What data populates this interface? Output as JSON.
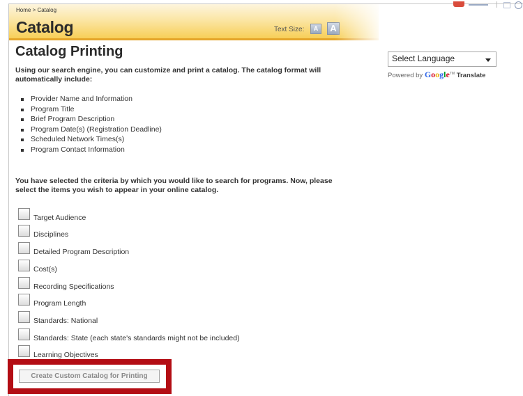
{
  "header": {
    "breadcrumb": "Home > Catalog",
    "title": "Catalog",
    "text_size_label": "Text Size:",
    "text_size_small": "A",
    "text_size_large": "A"
  },
  "content": {
    "title": "Catalog Printing",
    "intro": "Using our search engine, you can customize and print a catalog. The catalog format will automatically include:",
    "format_items": [
      "Provider Name and Information",
      "Program Title",
      "Brief Program Description",
      "Program Date(s) (Registration Deadline)",
      "Scheduled Network Times(s)",
      "Program Contact Information"
    ],
    "criteria_text": "You have selected the criteria by which you would like to search for programs. Now, please select the items you wish to appear in your online catalog.",
    "options": [
      {
        "label": "Target Audience",
        "checked": false
      },
      {
        "label": "Disciplines",
        "checked": false
      },
      {
        "label": "Detailed Program Description",
        "checked": false
      },
      {
        "label": "Cost(s)",
        "checked": false
      },
      {
        "label": "Recording Specifications",
        "checked": false
      },
      {
        "label": "Program Length",
        "checked": false
      },
      {
        "label": "Standards: National",
        "checked": false
      },
      {
        "label": "Standards: State (each state's standards might not be included)",
        "checked": false
      },
      {
        "label": "Learning Objectives",
        "checked": false
      }
    ],
    "create_button": "Create Custom Catalog for Printing"
  },
  "sidebar": {
    "language_select": "Select Language",
    "powered_by": "Powered by",
    "google_letters": [
      "G",
      "o",
      "o",
      "g",
      "l",
      "e"
    ],
    "tm": "TM",
    "translate": "Translate"
  },
  "colors": {
    "header_gold": "#f7cf58",
    "header_border": "#e5a52a",
    "highlight_red": "#b30d14"
  }
}
